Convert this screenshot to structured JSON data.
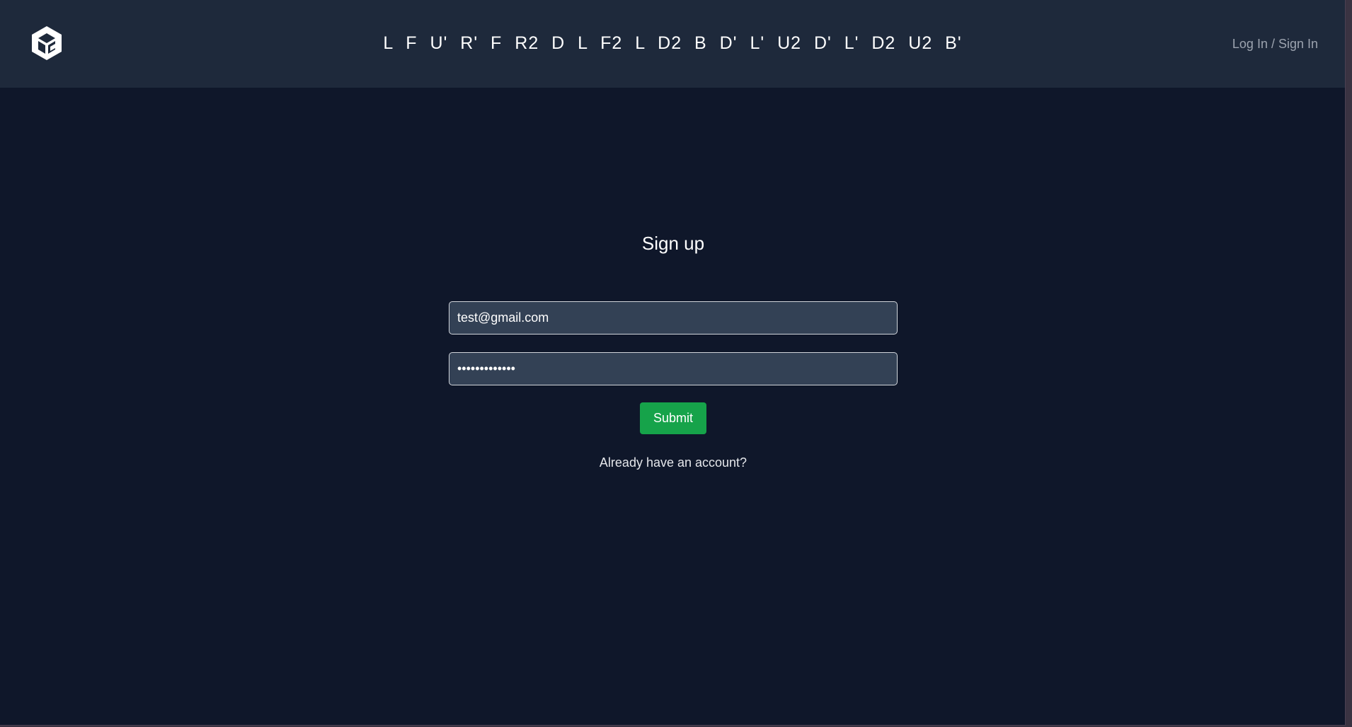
{
  "header": {
    "logo_icon": "cube-logo-icon",
    "scramble": "L F U' R' F R2 D L F2 L D2 B D' L' U2 D' L' D2 U2 B'",
    "auth_link": "Log In / Sign In"
  },
  "signup": {
    "title": "Sign up",
    "email_value": "test@gmail.com",
    "password_value": "•••••••••••••",
    "submit_label": "Submit",
    "login_link": "Already have an account?"
  },
  "colors": {
    "background": "#0f172a",
    "header": "#1e293b",
    "input_bg": "#334155",
    "submit": "#16a34a"
  }
}
